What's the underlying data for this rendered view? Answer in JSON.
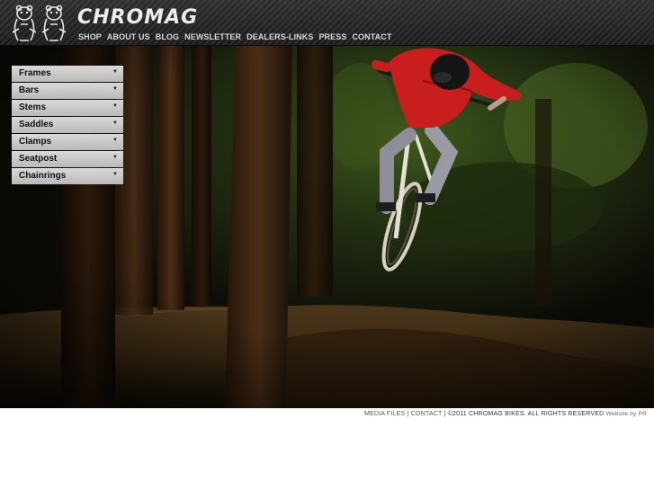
{
  "header": {
    "logo_text": "CHROMAG",
    "nav": [
      "SHOP",
      "ABOUT US",
      "BLOG",
      "NEWSLETTER",
      "DEALERS-LINKS",
      "PRESS",
      "CONTACT"
    ]
  },
  "side_menu": {
    "items": [
      {
        "label": "Frames"
      },
      {
        "label": "Bars"
      },
      {
        "label": "Stems"
      },
      {
        "label": "Saddles"
      },
      {
        "label": "Clamps"
      },
      {
        "label": "Seatpost"
      },
      {
        "label": "Chainrings"
      }
    ],
    "expand_icon": "triangle-down-icon"
  },
  "hero": {
    "image": "mountain-bike-rider-jump-forest-photo"
  },
  "footer": {
    "media_files": "MEDIA FILES",
    "sep1": "|",
    "contact": "CONTACT",
    "sep2": "|",
    "copyright": "©2011 CHROMAG BIKES. ALL RIGHTS RESERVED",
    "credit": "Website by PR"
  },
  "colors": {
    "header_bg": "#222222",
    "menu_bg": "#cccccc",
    "rider_shirt": "#c81e1e",
    "footer_text": "#444444"
  }
}
